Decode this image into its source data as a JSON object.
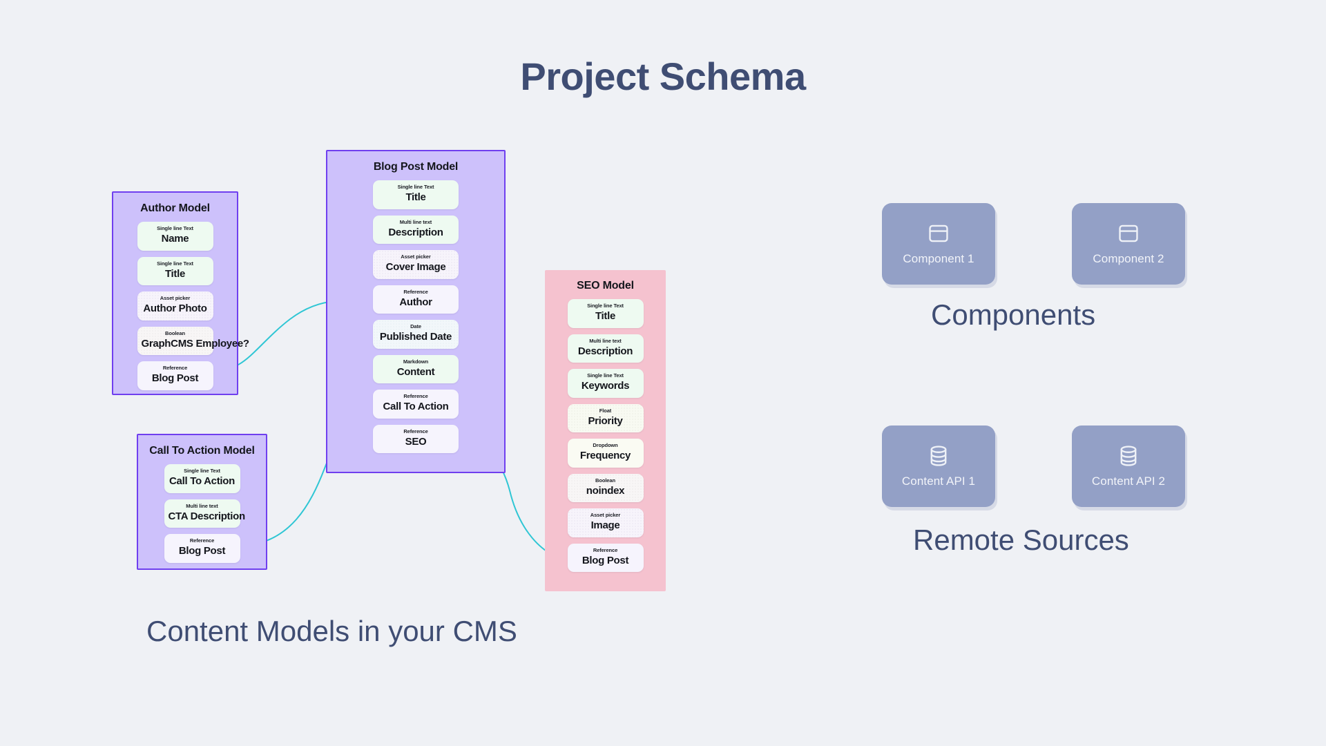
{
  "title": "Project Schema",
  "captions": {
    "cms": "Content Models in your CMS",
    "components": "Components",
    "remote_sources": "Remote Sources"
  },
  "colors": {
    "background": "#eff1f5",
    "title_text": "#3f4d73",
    "model_purple_fill": "#cdc1fb",
    "model_purple_border": "#6f3fef",
    "model_pink_fill": "#f5c2cf",
    "field_text_green": "#eefaf1",
    "tile_fill": "#93a0c6",
    "connector": "#2fc6d4"
  },
  "models": [
    {
      "id": "author-model",
      "name": "Author Model",
      "theme": "purple",
      "fields": [
        {
          "type": "Single line Text",
          "name": "Name",
          "style": "f-text"
        },
        {
          "type": "Single line Text",
          "name": "Title",
          "style": "f-text"
        },
        {
          "type": "Asset picker",
          "name": "Author Photo",
          "style": "f-asset"
        },
        {
          "type": "Boolean",
          "name": "GraphCMS Employee?",
          "style": "f-bool"
        },
        {
          "type": "Reference",
          "name": "Blog Post",
          "style": "f-ref"
        }
      ]
    },
    {
      "id": "blog-post-model",
      "name": "Blog Post Model",
      "theme": "purple",
      "fields": [
        {
          "type": "Single line Text",
          "name": "Title",
          "style": "f-text"
        },
        {
          "type": "Multi line text",
          "name": "Description",
          "style": "f-text"
        },
        {
          "type": "Asset picker",
          "name": "Cover Image",
          "style": "f-asset"
        },
        {
          "type": "Reference",
          "name": "Author",
          "style": "f-ref"
        },
        {
          "type": "Date",
          "name": "Published Date",
          "style": "f-date"
        },
        {
          "type": "Markdown",
          "name": "Content",
          "style": "f-md"
        },
        {
          "type": "Reference",
          "name": "Call To Action",
          "style": "f-ref"
        },
        {
          "type": "Reference",
          "name": "SEO",
          "style": "f-ref"
        }
      ]
    },
    {
      "id": "seo-model",
      "name": "SEO Model",
      "theme": "pink",
      "fields": [
        {
          "type": "Single line Text",
          "name": "Title",
          "style": "f-text"
        },
        {
          "type": "Multi line text",
          "name": "Description",
          "style": "f-text"
        },
        {
          "type": "Single line Text",
          "name": "Keywords",
          "style": "f-text"
        },
        {
          "type": "Float",
          "name": "Priority",
          "style": "f-float"
        },
        {
          "type": "Dropdown",
          "name": "Frequency",
          "style": "f-drop"
        },
        {
          "type": "Boolean",
          "name": "noindex",
          "style": "f-bool"
        },
        {
          "type": "Asset picker",
          "name": "Image",
          "style": "f-asset"
        },
        {
          "type": "Reference",
          "name": "Blog Post",
          "style": "f-ref"
        }
      ]
    },
    {
      "id": "call-to-action-model",
      "name": "Call To Action Model",
      "theme": "purple",
      "fields": [
        {
          "type": "Single line Text",
          "name": "Call To Action",
          "style": "f-text"
        },
        {
          "type": "Multi line text",
          "name": "CTA Description",
          "style": "f-text"
        },
        {
          "type": "Reference",
          "name": "Blog Post",
          "style": "f-ref"
        }
      ]
    }
  ],
  "tiles": [
    {
      "id": "component-1",
      "label": "Component 1",
      "icon": "component-icon"
    },
    {
      "id": "component-2",
      "label": "Component 2",
      "icon": "component-icon"
    },
    {
      "id": "content-api-1",
      "label": "Content API 1",
      "icon": "database-icon"
    },
    {
      "id": "content-api-2",
      "label": "Content API 2",
      "icon": "database-icon"
    }
  ],
  "connections": [
    {
      "from": "author-model.Blog Post",
      "to": "blog-post-model.Author"
    },
    {
      "from": "call-to-action-model.Blog Post",
      "to": "blog-post-model.Call To Action"
    },
    {
      "from": "seo-model.Blog Post",
      "to": "blog-post-model.SEO"
    }
  ]
}
